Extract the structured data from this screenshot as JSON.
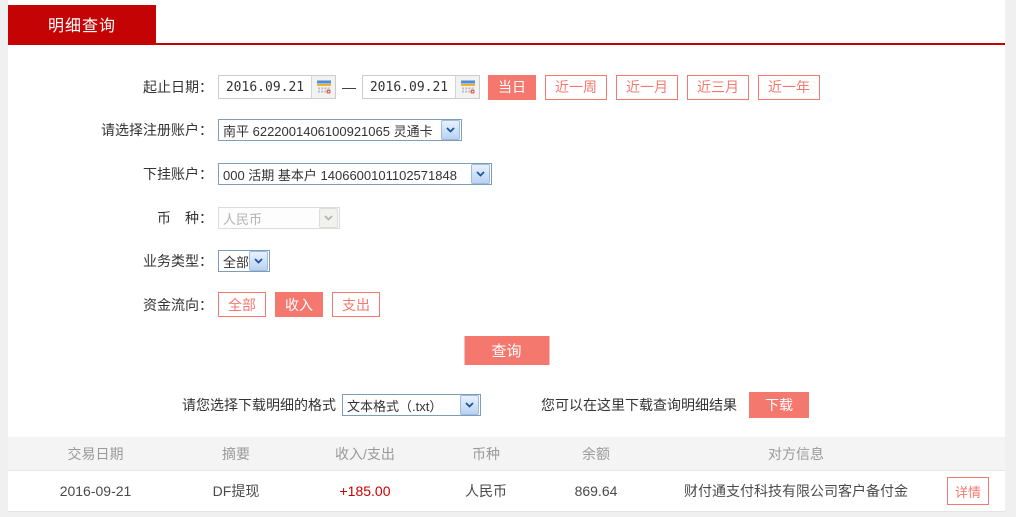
{
  "tab": {
    "label": "明细查询"
  },
  "colors": {
    "brand_red": "#c40404",
    "accent_salmon": "#f5786f",
    "amount_red": "#cc0000"
  },
  "form": {
    "date_label": "起止日期：",
    "date_from": "2016.09.21",
    "date_to": "2016.09.21",
    "date_separator": "—",
    "quick_ranges": [
      {
        "label": "当日"
      },
      {
        "label": "近一周"
      },
      {
        "label": "近一月"
      },
      {
        "label": "近三月"
      },
      {
        "label": "近一年"
      }
    ],
    "register_account": {
      "label": "请选择注册账户：",
      "value": "南平 6222001406100921065 灵通卡"
    },
    "sub_account": {
      "label": "下挂账户：",
      "value": "000 活期 基本户 1406600101102571848"
    },
    "currency": {
      "label": "币　种：",
      "value": "人民币"
    },
    "business_type": {
      "label": "业务类型：",
      "value": "全部"
    },
    "fund_flow": {
      "label": "资金流向：",
      "options": [
        {
          "label": "全部"
        },
        {
          "label": "收入"
        },
        {
          "label": "支出"
        }
      ]
    },
    "query_button": "查询"
  },
  "download": {
    "format_label": "请您选择下载明细的格式",
    "format_value": "文本格式（.txt）",
    "hint": "您可以在这里下载查询明细结果",
    "button": "下载"
  },
  "table": {
    "headers": [
      "交易日期",
      "摘要",
      "收入/支出",
      "币种",
      "余额",
      "对方信息"
    ],
    "rows": [
      {
        "date": "2016-09-21",
        "summary": "DF提现",
        "amount": "+185.00",
        "currency": "人民币",
        "balance": "869.64",
        "counterparty": "财付通支付科技有限公司客户备付金",
        "action": "详情"
      }
    ]
  }
}
